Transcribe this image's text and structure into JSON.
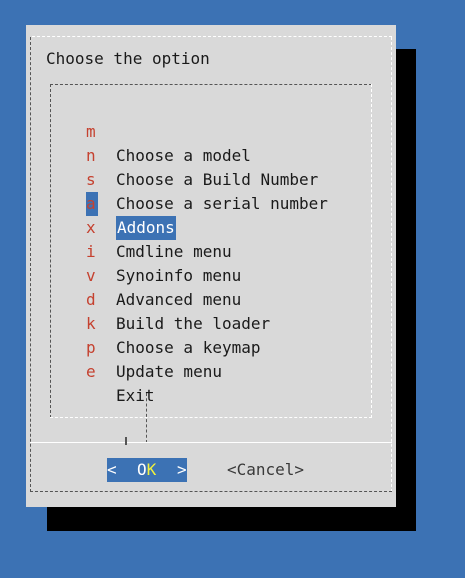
{
  "dialog": {
    "title": "Choose the option"
  },
  "menu": {
    "items": [
      {
        "key": "m",
        "label": "Choose a model"
      },
      {
        "key": "n",
        "label": "Choose a Build Number"
      },
      {
        "key": "s",
        "label": "Choose a serial number"
      },
      {
        "key": "a",
        "label": "Addons",
        "selected": true
      },
      {
        "key": "x",
        "label": "Cmdline menu"
      },
      {
        "key": "i",
        "label": "Synoinfo menu"
      },
      {
        "key": "v",
        "label": "Advanced menu"
      },
      {
        "key": "d",
        "label": "Build the loader"
      },
      {
        "key": "k",
        "label": "Choose a keymap"
      },
      {
        "key": "p",
        "label": "Update menu"
      },
      {
        "key": "e",
        "label": "Exit"
      }
    ]
  },
  "buttons": {
    "ok": {
      "left": "<",
      "first": "O",
      "hot": "K",
      "right": ">"
    },
    "cancel_label": "<Cancel>"
  },
  "colors": {
    "background": "#3c72b4",
    "dialog": "#d9d9d9",
    "hotkey": "#c5412f",
    "button_hotkey": "#f2f23c"
  }
}
